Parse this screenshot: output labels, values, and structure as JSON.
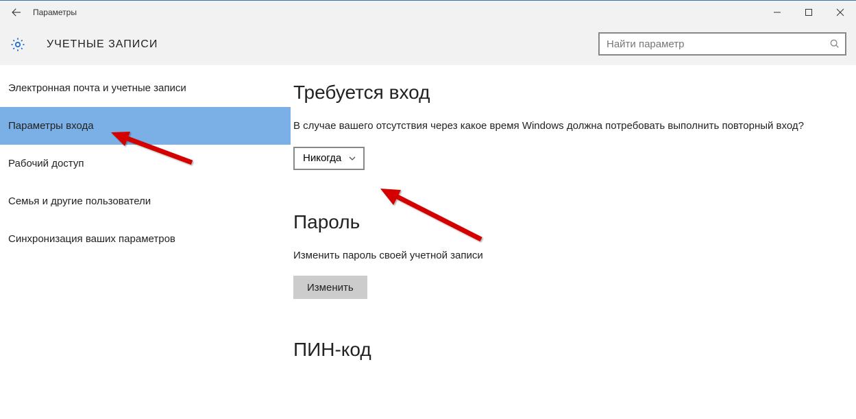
{
  "titlebar": {
    "app_title": "Параметры"
  },
  "header": {
    "section_title": "УЧЕТНЫЕ ЗАПИСИ",
    "search_placeholder": "Найти параметр"
  },
  "sidebar": {
    "items": [
      {
        "label": "Электронная почта и учетные записи"
      },
      {
        "label": "Параметры входа"
      },
      {
        "label": "Рабочий доступ"
      },
      {
        "label": "Семья и другие пользователи"
      },
      {
        "label": "Синхронизация ваших параметров"
      }
    ],
    "selected_index": 1
  },
  "content": {
    "signin_required": {
      "heading": "Требуется вход",
      "description": "В случае вашего отсутствия через какое время Windows должна потребовать выполнить повторный вход?",
      "dropdown_value": "Никогда"
    },
    "password": {
      "heading": "Пароль",
      "description": "Изменить пароль своей учетной записи",
      "button_label": "Изменить"
    },
    "pin": {
      "heading": "ПИН-код"
    }
  }
}
